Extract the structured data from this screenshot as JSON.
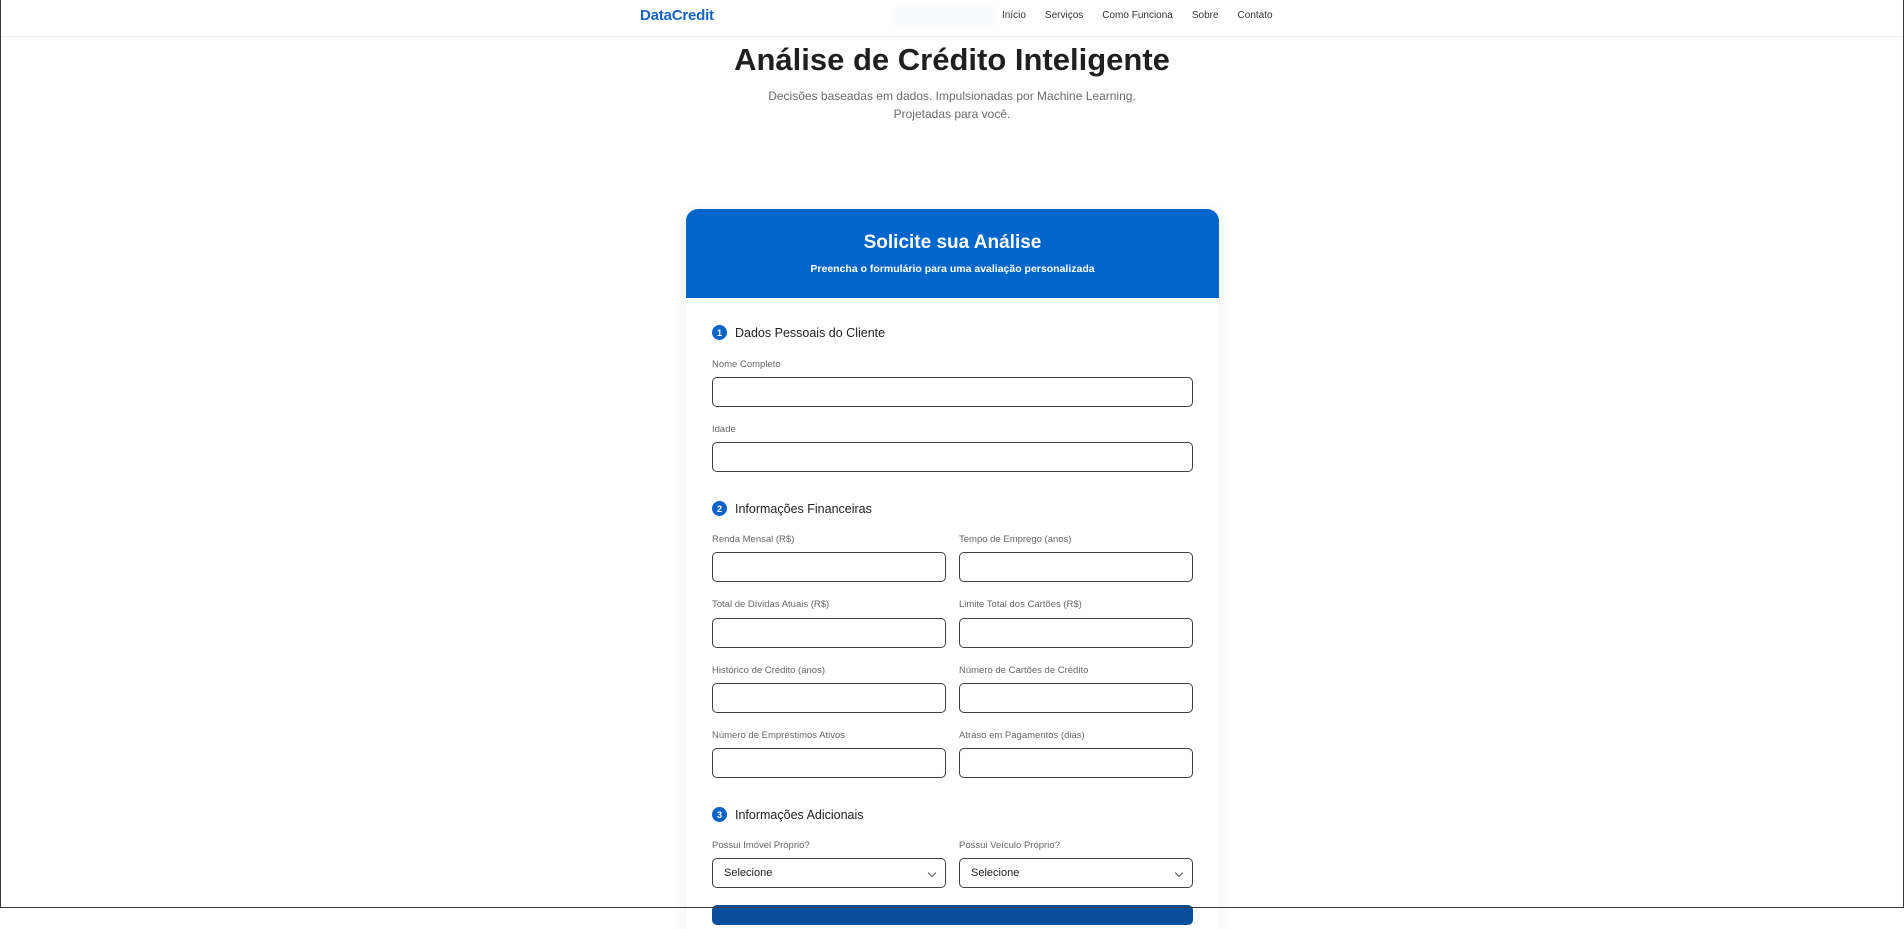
{
  "nav": {
    "brand": "DataCredit",
    "links": [
      "Início",
      "Serviços",
      "Como Funciona",
      "Sobre",
      "Contato"
    ]
  },
  "hero": {
    "title": "Análise de Crédito Inteligente",
    "subtitle_line1": "Decisões baseadas em dados. Impulsionadas por Machine Learning.",
    "subtitle_line2": "Projetadas para você."
  },
  "form": {
    "title": "Solicite sua Análise",
    "subtitle": "Preencha o formulário para uma avaliação personalizada",
    "sections": [
      {
        "number": "1",
        "title": "Dados Pessoais do Cliente",
        "fields": [
          "Nome Completo",
          "Idade"
        ]
      },
      {
        "number": "2",
        "title": "Informações Financeiras",
        "fields": [
          "Renda Mensal (R$)",
          "Tempo de Emprego (anos)",
          "Total de Dívidas Atuais (R$)",
          "Limite Total dos Cartões (R$)",
          "Histórico de Crédito (anos)",
          "Número de Cartões de Crédito",
          "Número de Empréstimos Ativos",
          "Atraso em Pagamentos (dias)"
        ]
      },
      {
        "number": "3",
        "title": "Informações Adicionais",
        "fields": [
          "Possui Imóvel Próprio?",
          "Possui Veículo Próprio?"
        ],
        "select_values": [
          "Selecione",
          "Selecione"
        ]
      }
    ]
  },
  "colors": {
    "primary": "#0066cc",
    "brand": "#1565c0",
    "badge": "#0b63c5"
  }
}
